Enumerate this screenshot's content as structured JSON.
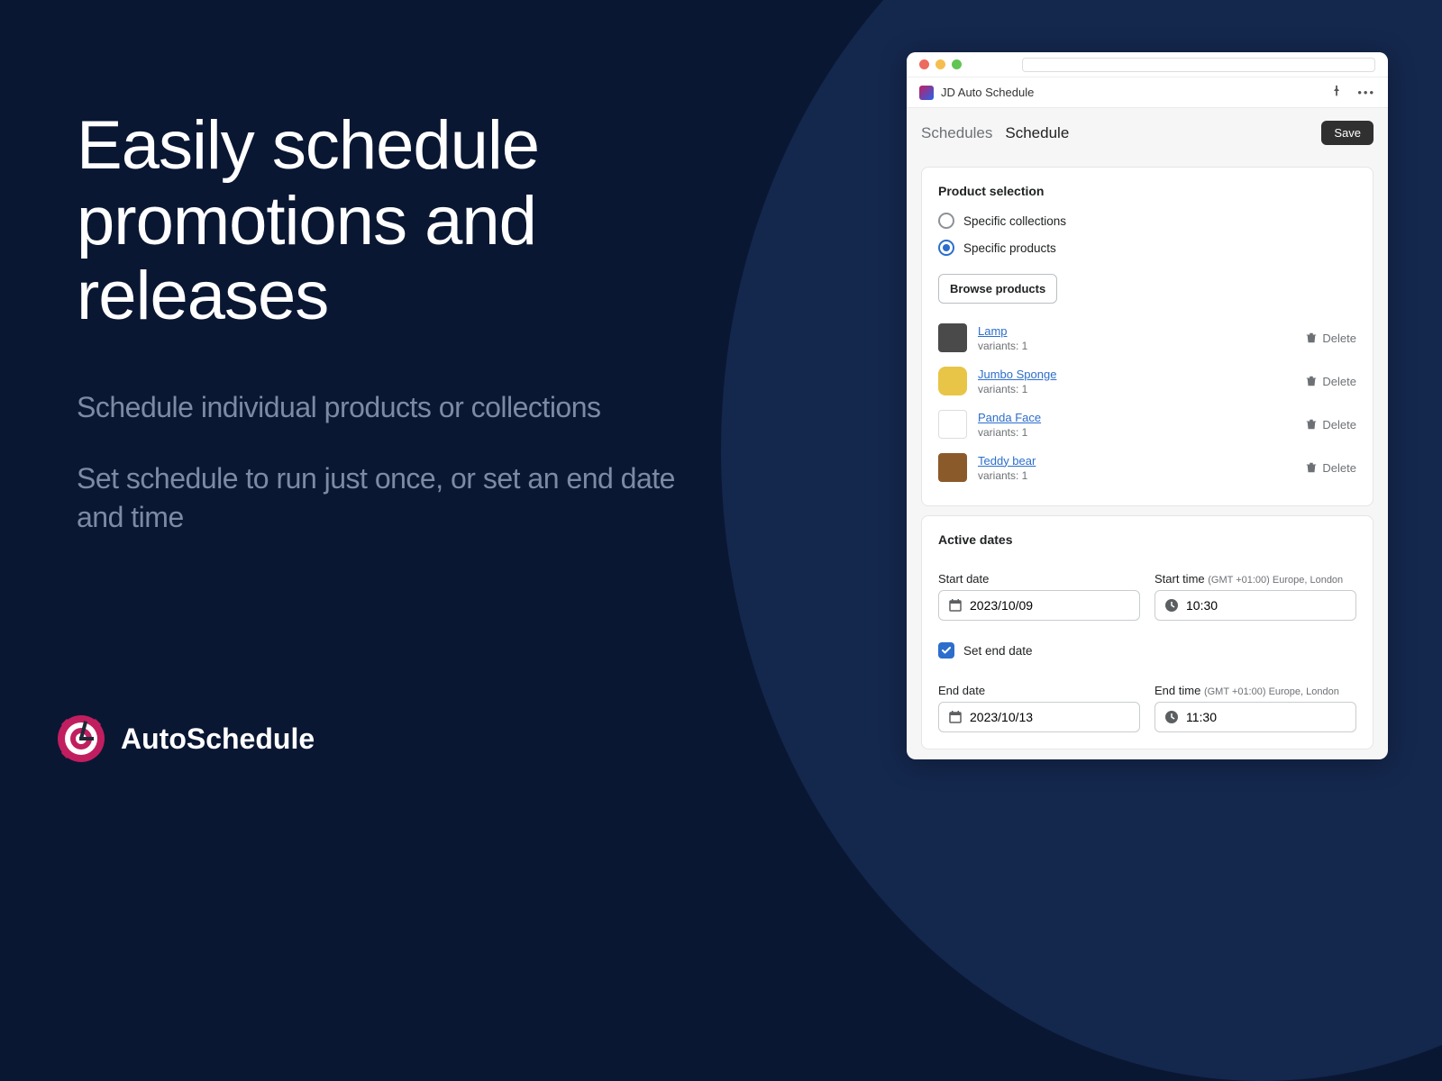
{
  "hero": {
    "title": "Easily schedule promotions and releases",
    "sub1": "Schedule individual products or collections",
    "sub2": "Set schedule to run just once, or set an end date and time"
  },
  "brand": {
    "name": "AutoSchedule"
  },
  "app": {
    "name": "JD Auto Schedule",
    "crumb_parent": "Schedules",
    "crumb_current": "Schedule",
    "save": "Save"
  },
  "productSelection": {
    "title": "Product selection",
    "option_collections": "Specific collections",
    "option_products": "Specific products",
    "browse": "Browse products",
    "deleteLabel": "Delete",
    "variantsLabel": "variants: 1",
    "items": [
      {
        "name": "Lamp",
        "img": "lamp"
      },
      {
        "name": "Jumbo Sponge",
        "img": "sponge"
      },
      {
        "name": "Panda Face",
        "img": "panda"
      },
      {
        "name": "Teddy bear",
        "img": "teddy"
      }
    ]
  },
  "dates": {
    "title": "Active dates",
    "startDateLabel": "Start date",
    "startTimeLabel": "Start time",
    "tzHint": "(GMT +01:00) Europe, London",
    "startDate": "2023/10/09",
    "startTime": "10:30",
    "setEndLabel": "Set end date",
    "endDateLabel": "End date",
    "endTimeLabel": "End time",
    "endDate": "2023/10/13",
    "endTime": "11:30"
  }
}
